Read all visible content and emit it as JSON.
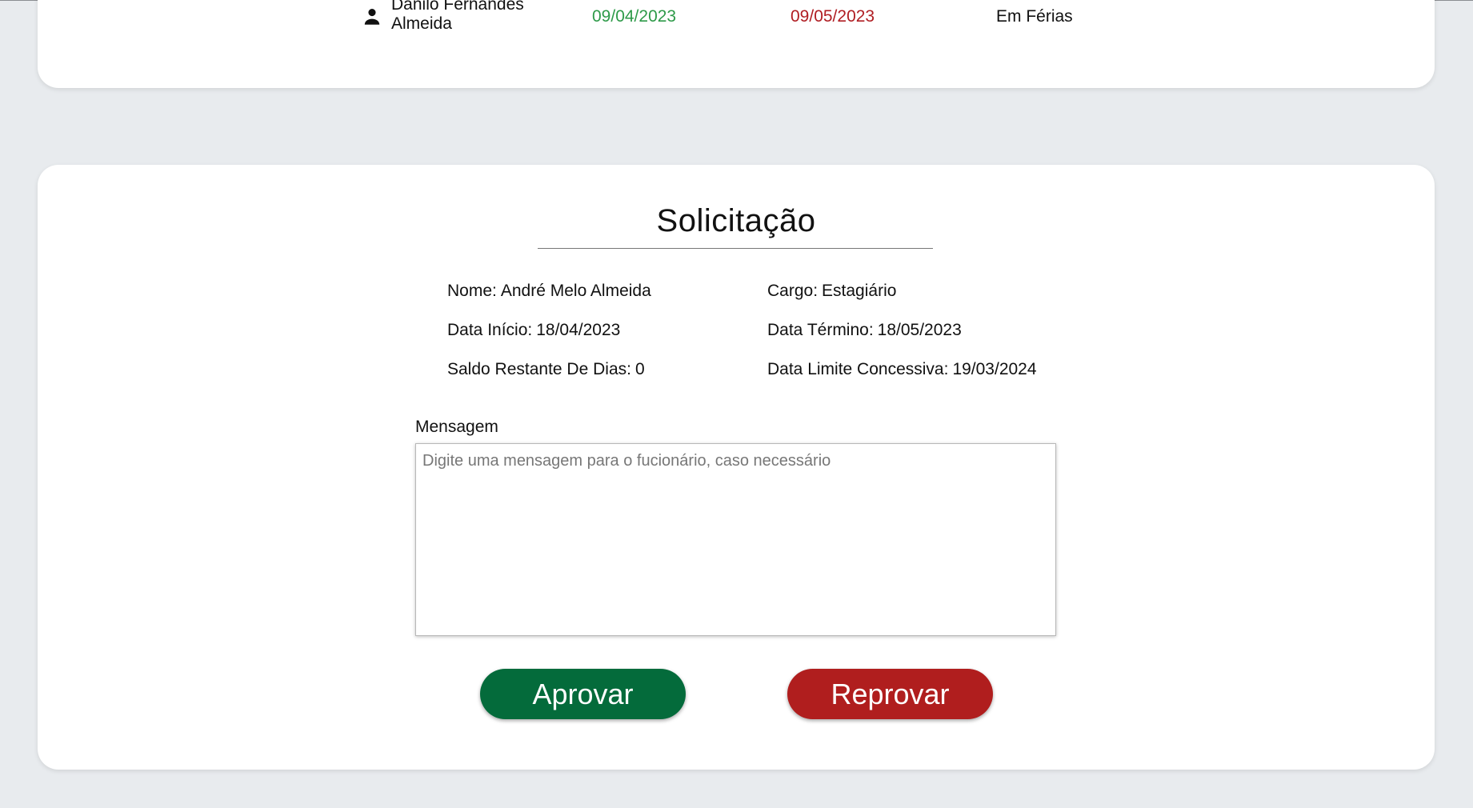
{
  "employee_row": {
    "icon": "person-icon",
    "name": "Danilo Fernandes Almeida",
    "start_date": "09/04/2023",
    "end_date": "09/05/2023",
    "status": "Em Férias",
    "colors": {
      "start_date": "#2e9a49",
      "end_date": "#b01e23"
    }
  },
  "request": {
    "title": "Solicitação",
    "fields": {
      "nome": {
        "label": "Nome:",
        "value": "André Melo Almeida"
      },
      "cargo": {
        "label": "Cargo:",
        "value": "Estagiário"
      },
      "data_inicio": {
        "label": "Data Início:",
        "value": "18/04/2023"
      },
      "data_termino": {
        "label": "Data Término:",
        "value": "18/05/2023"
      },
      "saldo": {
        "label": "Saldo Restante De Dias:",
        "value": "0"
      },
      "data_limite": {
        "label": "Data Limite Concessiva:",
        "value": "19/03/2024"
      }
    },
    "message": {
      "label": "Mensagem",
      "value": "",
      "placeholder": "Digite uma mensagem para o fucionário, caso necessário"
    },
    "buttons": {
      "approve": "Aprovar",
      "reject": "Reprovar"
    },
    "colors": {
      "approve": "#046b3b",
      "reject": "#b01e1e"
    }
  }
}
